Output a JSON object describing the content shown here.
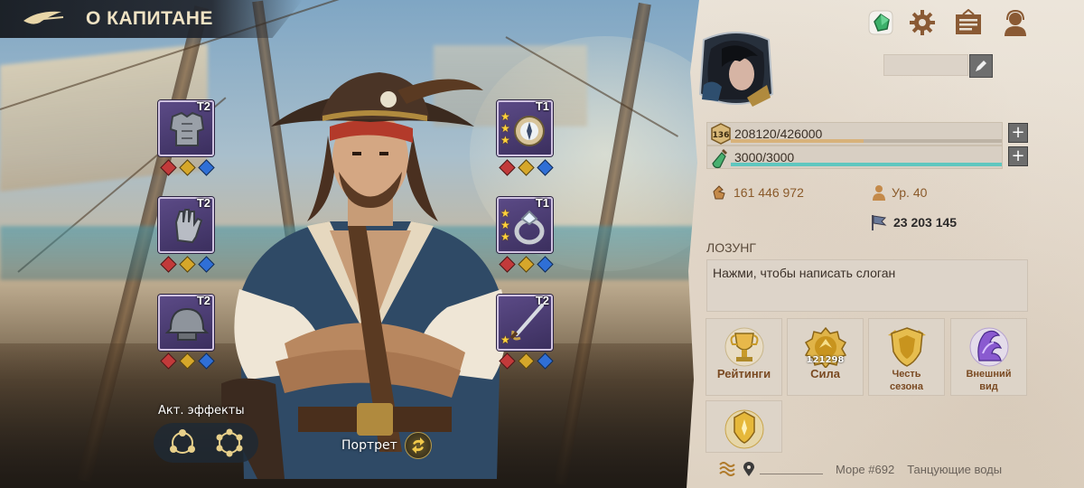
{
  "header": {
    "title": "О КАПИТАНЕ"
  },
  "equipment": {
    "left": [
      {
        "name": "armor",
        "tier": "T2"
      },
      {
        "name": "gloves",
        "tier": "T2"
      },
      {
        "name": "helmet",
        "tier": "T2"
      }
    ],
    "right": [
      {
        "name": "compass",
        "tier": "T1",
        "stars": 3
      },
      {
        "name": "ring",
        "tier": "T1",
        "stars": 3
      },
      {
        "name": "saber",
        "tier": "T2",
        "stars": 1
      }
    ]
  },
  "effects": {
    "label": "Акт. эффекты"
  },
  "portrait": {
    "label": "Портрет"
  },
  "profile": {
    "level_badge": "136",
    "experience": "208120/426000",
    "experience_fraction": 0.49,
    "stamina": "3000/3000",
    "stamina_fraction": 1.0,
    "currency": "161 446 972",
    "level": "Ур. 40",
    "power_score": "23 203 145",
    "motto_label": "ЛОЗУНГ",
    "motto_placeholder": "Нажми, чтобы написать слоган"
  },
  "cards": [
    {
      "label": "Рейтинги",
      "icon": "trophy-icon"
    },
    {
      "label": "Сила",
      "value": "121298",
      "icon": "power-medal-icon"
    },
    {
      "label": "Честь сезона",
      "icon": "season-shield-icon"
    },
    {
      "label": "Внешний вид",
      "icon": "appearance-icon"
    },
    {
      "label": "",
      "icon": "gold-emblem-icon"
    }
  ],
  "footer": {
    "sea": "Море #692",
    "region": "Танцующие воды"
  },
  "colors": {
    "exp_bar": "#d8b27a",
    "stamina_bar": "#5fc7bf",
    "panel_bg": "#e8e0d4",
    "label_brown": "#7a4a22"
  }
}
